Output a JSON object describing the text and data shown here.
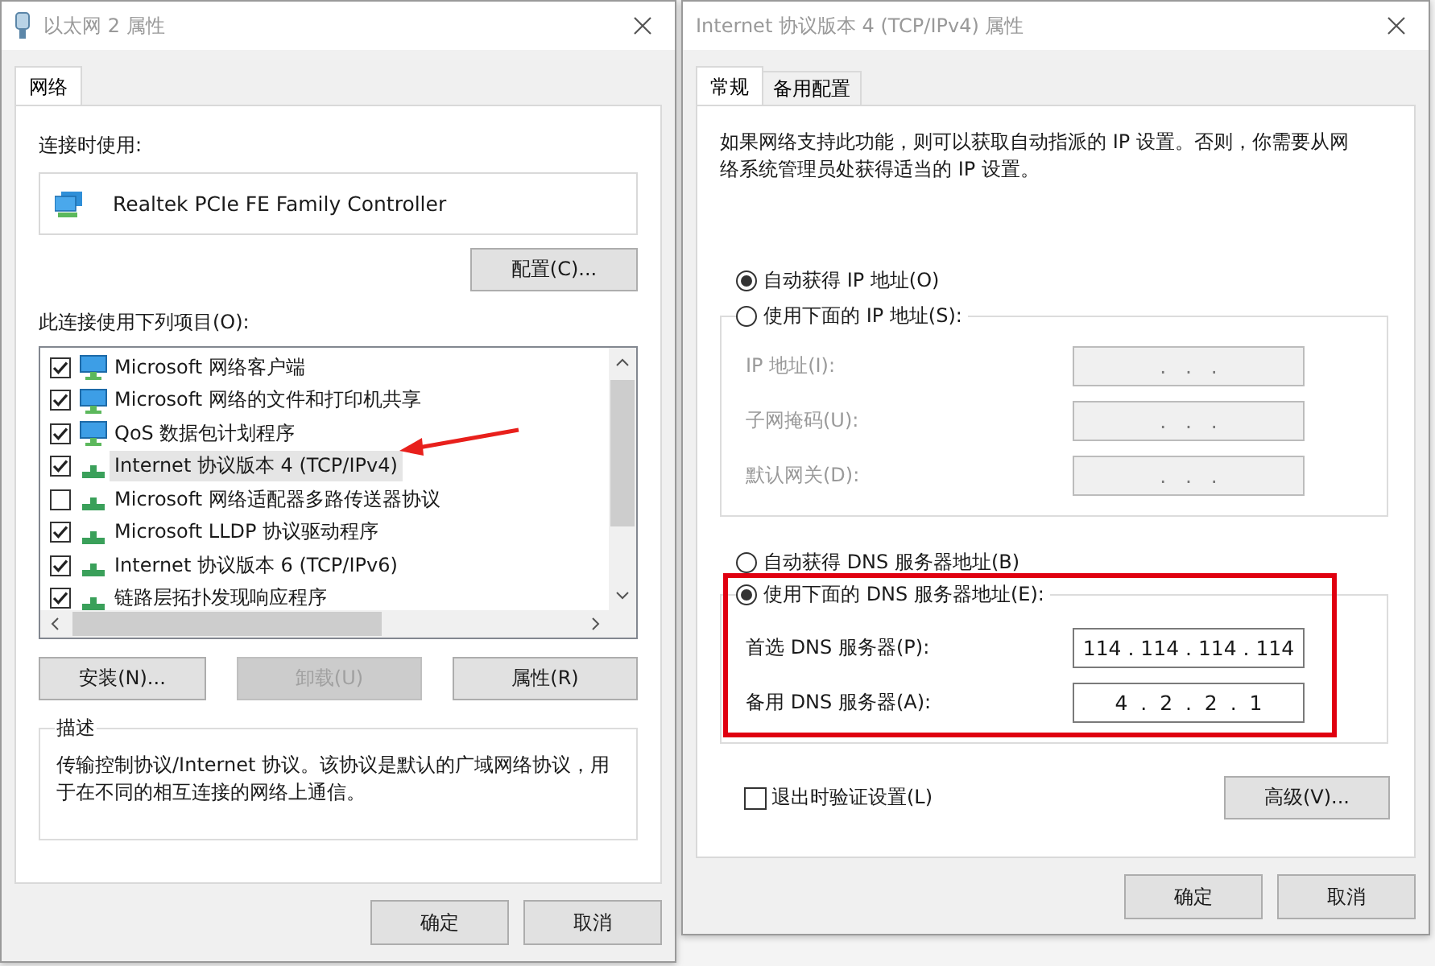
{
  "left_window": {
    "title": "以太网 2 属性",
    "tabs": [
      {
        "label": "网络",
        "selected": true
      }
    ],
    "connect_using_label": "连接时使用:",
    "adapter_name": "Realtek PCIe FE Family Controller",
    "configure_button": "配置(C)...",
    "items_label": "此连接使用下列项目(O):",
    "items": [
      {
        "label": "Microsoft 网络客户端",
        "checked": true,
        "selected": false,
        "kind": "client",
        "pointed": false
      },
      {
        "label": "Microsoft 网络的文件和打印机共享",
        "checked": true,
        "selected": false,
        "kind": "client",
        "pointed": false
      },
      {
        "label": "QoS 数据包计划程序",
        "checked": true,
        "selected": false,
        "kind": "client",
        "pointed": false
      },
      {
        "label": "Internet 协议版本 4 (TCP/IPv4)",
        "checked": true,
        "selected": true,
        "kind": "protocol",
        "pointed": true
      },
      {
        "label": "Microsoft 网络适配器多路传送器协议",
        "checked": false,
        "selected": false,
        "kind": "protocol",
        "pointed": false
      },
      {
        "label": "Microsoft LLDP 协议驱动程序",
        "checked": true,
        "selected": false,
        "kind": "protocol",
        "pointed": false
      },
      {
        "label": "Internet 协议版本 6 (TCP/IPv6)",
        "checked": true,
        "selected": false,
        "kind": "protocol",
        "pointed": false
      },
      {
        "label": "链路层拓扑发现响应程序",
        "checked": true,
        "selected": false,
        "kind": "protocol",
        "pointed": false
      }
    ],
    "item_buttons": [
      {
        "label": "安装(N)...",
        "disabled": false
      },
      {
        "label": "卸载(U)",
        "disabled": true
      },
      {
        "label": "属性(R)",
        "disabled": false
      }
    ],
    "description": {
      "title": "描述",
      "text": "传输控制协议/Internet 协议。该协议是默认的广域网络协议，用于在不同的相互连接的网络上通信。"
    },
    "buttons": [
      "确定",
      "取消"
    ]
  },
  "right_window": {
    "title": "Internet 协议版本 4 (TCP/IPv4) 属性",
    "tabs": [
      {
        "label": "常规",
        "selected": true
      },
      {
        "label": "备用配置",
        "selected": false
      }
    ],
    "intro": "如果网络支持此功能，则可以获取自动指派的 IP 设置。否则，你需要从网络系统管理员处获得适当的 IP 设置。",
    "ip_auto": {
      "label": "自动获得 IP 地址(O)",
      "selected": true
    },
    "ip_manual": {
      "label": "使用下面的 IP 地址(S):",
      "selected": false,
      "disabled": true,
      "fields": [
        {
          "label": "IP 地址(I):",
          "value": ".   .   ."
        },
        {
          "label": "子网掩码(U):",
          "value": ".   .   ."
        },
        {
          "label": "默认网关(D):",
          "value": ".   .   ."
        }
      ]
    },
    "dns_auto": {
      "label": "自动获得 DNS 服务器地址(B)",
      "selected": false
    },
    "dns_manual": {
      "label": "使用下面的 DNS 服务器地址(E):",
      "selected": true,
      "disabled": false,
      "highlighted": true,
      "fields": [
        {
          "label": "首选 DNS 服务器(P):",
          "value": "114 . 114 . 114 . 114"
        },
        {
          "label": "备用 DNS 服务器(A):",
          "value": "4  .  2  .  2  .  1"
        }
      ]
    },
    "validate": {
      "label": "退出时验证设置(L)",
      "checked": false
    },
    "advanced_button": "高级(V)...",
    "buttons": [
      "确定",
      "取消"
    ]
  }
}
